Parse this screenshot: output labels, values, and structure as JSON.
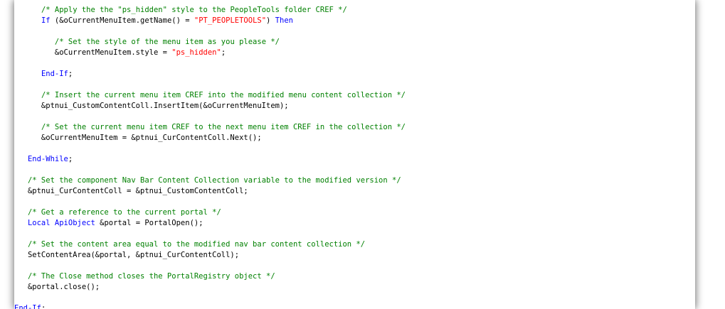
{
  "colors": {
    "comment": "#008000",
    "keyword": "#0000ff",
    "string": "#ff0000",
    "text": "#000000"
  },
  "code_lines": [
    [
      {
        "t": "      ",
        "c": "pl"
      },
      {
        "t": "/* Apply the the \"ps_hidden\" style to the PeopleTools folder CREF */",
        "c": "cm"
      }
    ],
    [
      {
        "t": "      ",
        "c": "pl"
      },
      {
        "t": "If",
        "c": "kw"
      },
      {
        "t": " (&oCurrentMenuItem.getName() = ",
        "c": "pl"
      },
      {
        "t": "\"PT_PEOPLETOOLS\"",
        "c": "st"
      },
      {
        "t": ") ",
        "c": "pl"
      },
      {
        "t": "Then",
        "c": "kw"
      }
    ],
    [],
    [
      {
        "t": "         ",
        "c": "pl"
      },
      {
        "t": "/* Set the style of the menu item as you please */",
        "c": "cm"
      }
    ],
    [
      {
        "t": "         &oCurrentMenuItem.style = ",
        "c": "pl"
      },
      {
        "t": "\"ps_hidden\"",
        "c": "st"
      },
      {
        "t": ";",
        "c": "pl"
      }
    ],
    [],
    [
      {
        "t": "      ",
        "c": "pl"
      },
      {
        "t": "End-If",
        "c": "kw"
      },
      {
        "t": ";",
        "c": "pl"
      }
    ],
    [],
    [
      {
        "t": "      ",
        "c": "pl"
      },
      {
        "t": "/* Insert the current menu item CREF into the modified menu content collection */",
        "c": "cm"
      }
    ],
    [
      {
        "t": "      &ptnui_CustomContentColl.InsertItem(&oCurrentMenuItem);",
        "c": "pl"
      }
    ],
    [],
    [
      {
        "t": "      ",
        "c": "pl"
      },
      {
        "t": "/* Set the current menu item CREF to the next menu item CREF in the collection */",
        "c": "cm"
      }
    ],
    [
      {
        "t": "      &oCurrentMenuItem = &ptnui_CurContentColl.Next();",
        "c": "pl"
      }
    ],
    [],
    [
      {
        "t": "   ",
        "c": "pl"
      },
      {
        "t": "End-While",
        "c": "kw"
      },
      {
        "t": ";",
        "c": "pl"
      }
    ],
    [],
    [
      {
        "t": "   ",
        "c": "pl"
      },
      {
        "t": "/* Set the component Nav Bar Content Collection variable to the modified version */",
        "c": "cm"
      }
    ],
    [
      {
        "t": "   &ptnui_CurContentColl = &ptnui_CustomContentColl;",
        "c": "pl"
      }
    ],
    [],
    [
      {
        "t": "   ",
        "c": "pl"
      },
      {
        "t": "/* Get a reference to the current portal */",
        "c": "cm"
      }
    ],
    [
      {
        "t": "   ",
        "c": "pl"
      },
      {
        "t": "Local",
        "c": "kw"
      },
      {
        "t": " ",
        "c": "pl"
      },
      {
        "t": "ApiObject",
        "c": "kw"
      },
      {
        "t": " &portal = PortalOpen();",
        "c": "pl"
      }
    ],
    [],
    [
      {
        "t": "   ",
        "c": "pl"
      },
      {
        "t": "/* Set the content area equal to the modified nav bar content collection */",
        "c": "cm"
      }
    ],
    [
      {
        "t": "   SetContentArea(&portal, &ptnui_CurContentColl);",
        "c": "pl"
      }
    ],
    [],
    [
      {
        "t": "   ",
        "c": "pl"
      },
      {
        "t": "/* The Close method closes the PortalRegistry object */",
        "c": "cm"
      }
    ],
    [
      {
        "t": "   &portal.close();",
        "c": "pl"
      }
    ],
    [],
    [
      {
        "t": "",
        "c": "pl"
      },
      {
        "t": "End-If",
        "c": "kw"
      },
      {
        "t": ";",
        "c": "pl"
      }
    ]
  ]
}
